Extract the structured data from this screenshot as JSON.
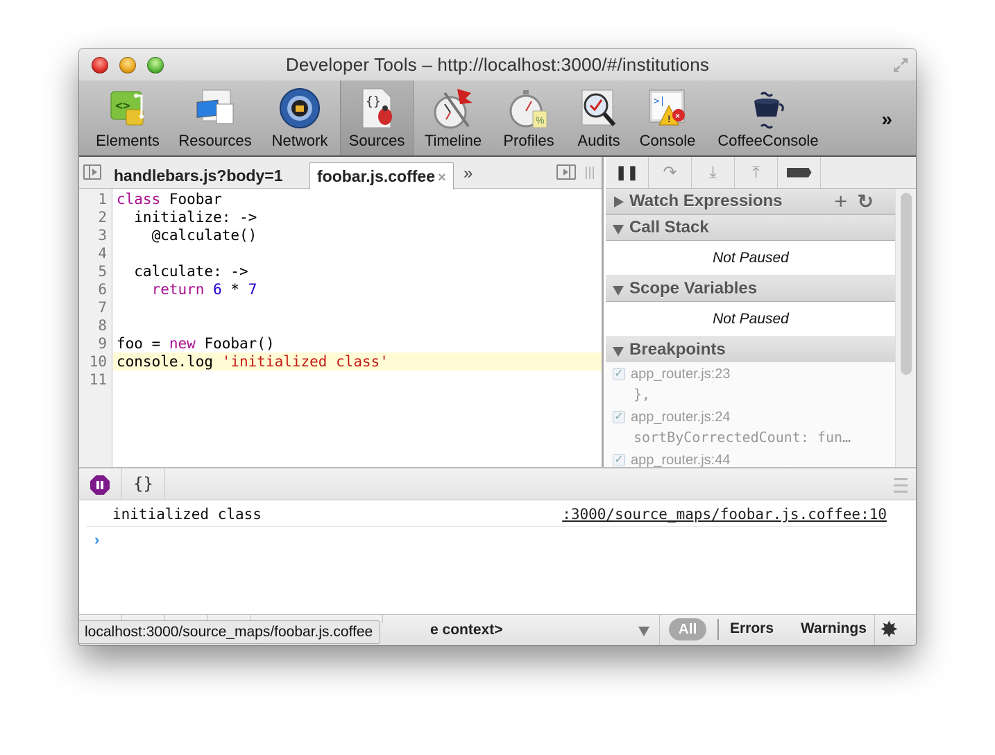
{
  "window": {
    "title": "Developer Tools – http://localhost:3000/#/institutions"
  },
  "toolbar": {
    "items": [
      {
        "label": "Elements",
        "icon": "elements-icon"
      },
      {
        "label": "Resources",
        "icon": "resources-icon"
      },
      {
        "label": "Network",
        "icon": "network-icon"
      },
      {
        "label": "Sources",
        "icon": "sources-icon",
        "active": true
      },
      {
        "label": "Timeline",
        "icon": "timeline-icon"
      },
      {
        "label": "Profiles",
        "icon": "profiles-icon"
      },
      {
        "label": "Audits",
        "icon": "audits-icon"
      },
      {
        "label": "Console",
        "icon": "console-icon"
      },
      {
        "label": "CoffeeConsole",
        "icon": "coffee-cup-icon"
      }
    ],
    "overflow_label": "»"
  },
  "editor": {
    "tabs": [
      {
        "label": "handlebars.js?body=1"
      },
      {
        "label": "foobar.js.coffee",
        "active": true,
        "close": "×"
      }
    ],
    "tab_overflow": "»",
    "highlighted_line": 10,
    "lines": [
      {
        "n": "1",
        "tokens": [
          {
            "t": "kw",
            "v": "class"
          },
          {
            "t": "",
            "v": " Foobar"
          }
        ]
      },
      {
        "n": "2",
        "tokens": [
          {
            "t": "",
            "v": "  initialize: ->"
          }
        ]
      },
      {
        "n": "3",
        "tokens": [
          {
            "t": "",
            "v": "    @calculate()"
          }
        ]
      },
      {
        "n": "4",
        "tokens": []
      },
      {
        "n": "5",
        "tokens": [
          {
            "t": "",
            "v": "  calculate: ->"
          }
        ]
      },
      {
        "n": "6",
        "tokens": [
          {
            "t": "",
            "v": "    "
          },
          {
            "t": "kw",
            "v": "return"
          },
          {
            "t": "",
            "v": " "
          },
          {
            "t": "num",
            "v": "6"
          },
          {
            "t": "",
            "v": " * "
          },
          {
            "t": "num",
            "v": "7"
          }
        ]
      },
      {
        "n": "7",
        "tokens": []
      },
      {
        "n": "8",
        "tokens": []
      },
      {
        "n": "9",
        "tokens": [
          {
            "t": "",
            "v": "foo = "
          },
          {
            "t": "kw",
            "v": "new"
          },
          {
            "t": "",
            "v": " Foobar()"
          }
        ]
      },
      {
        "n": "10",
        "tokens": [
          {
            "t": "",
            "v": "console.log "
          },
          {
            "t": "str",
            "v": "'initialized class'"
          }
        ]
      },
      {
        "n": "11",
        "tokens": []
      }
    ]
  },
  "debugger": {
    "buttons": {
      "pause": "❚❚",
      "step_over": "↷",
      "step_into": "⤓",
      "step_out": "⤒"
    },
    "watch": {
      "title": "Watch Expressions",
      "add": "+",
      "refresh": "↻"
    },
    "call_stack": {
      "title": "Call Stack",
      "status": "Not Paused"
    },
    "scope": {
      "title": "Scope Variables",
      "status": "Not Paused"
    },
    "breakpoints": {
      "title": "Breakpoints",
      "items": [
        {
          "location": "app_router.js:23",
          "code": "},",
          "checked": true
        },
        {
          "location": "app_router.js:24",
          "code": "sortByCorrectedCount: fun…",
          "checked": true
        },
        {
          "location": "app_router.js:44",
          "code": "",
          "checked": true
        }
      ]
    }
  },
  "console": {
    "pretty_print": "{}",
    "messages": [
      {
        "text": "initialized class",
        "source": ":3000/source_maps/foobar.js.coffee:10"
      }
    ],
    "prompt": "›"
  },
  "statusbar": {
    "context": "e context>",
    "filters": {
      "all": "All",
      "errors": "Errors",
      "warnings": "Warnings"
    },
    "settings": "✸"
  },
  "tooltip": {
    "text": "localhost:3000/source_maps/foobar.js.coffee"
  }
}
